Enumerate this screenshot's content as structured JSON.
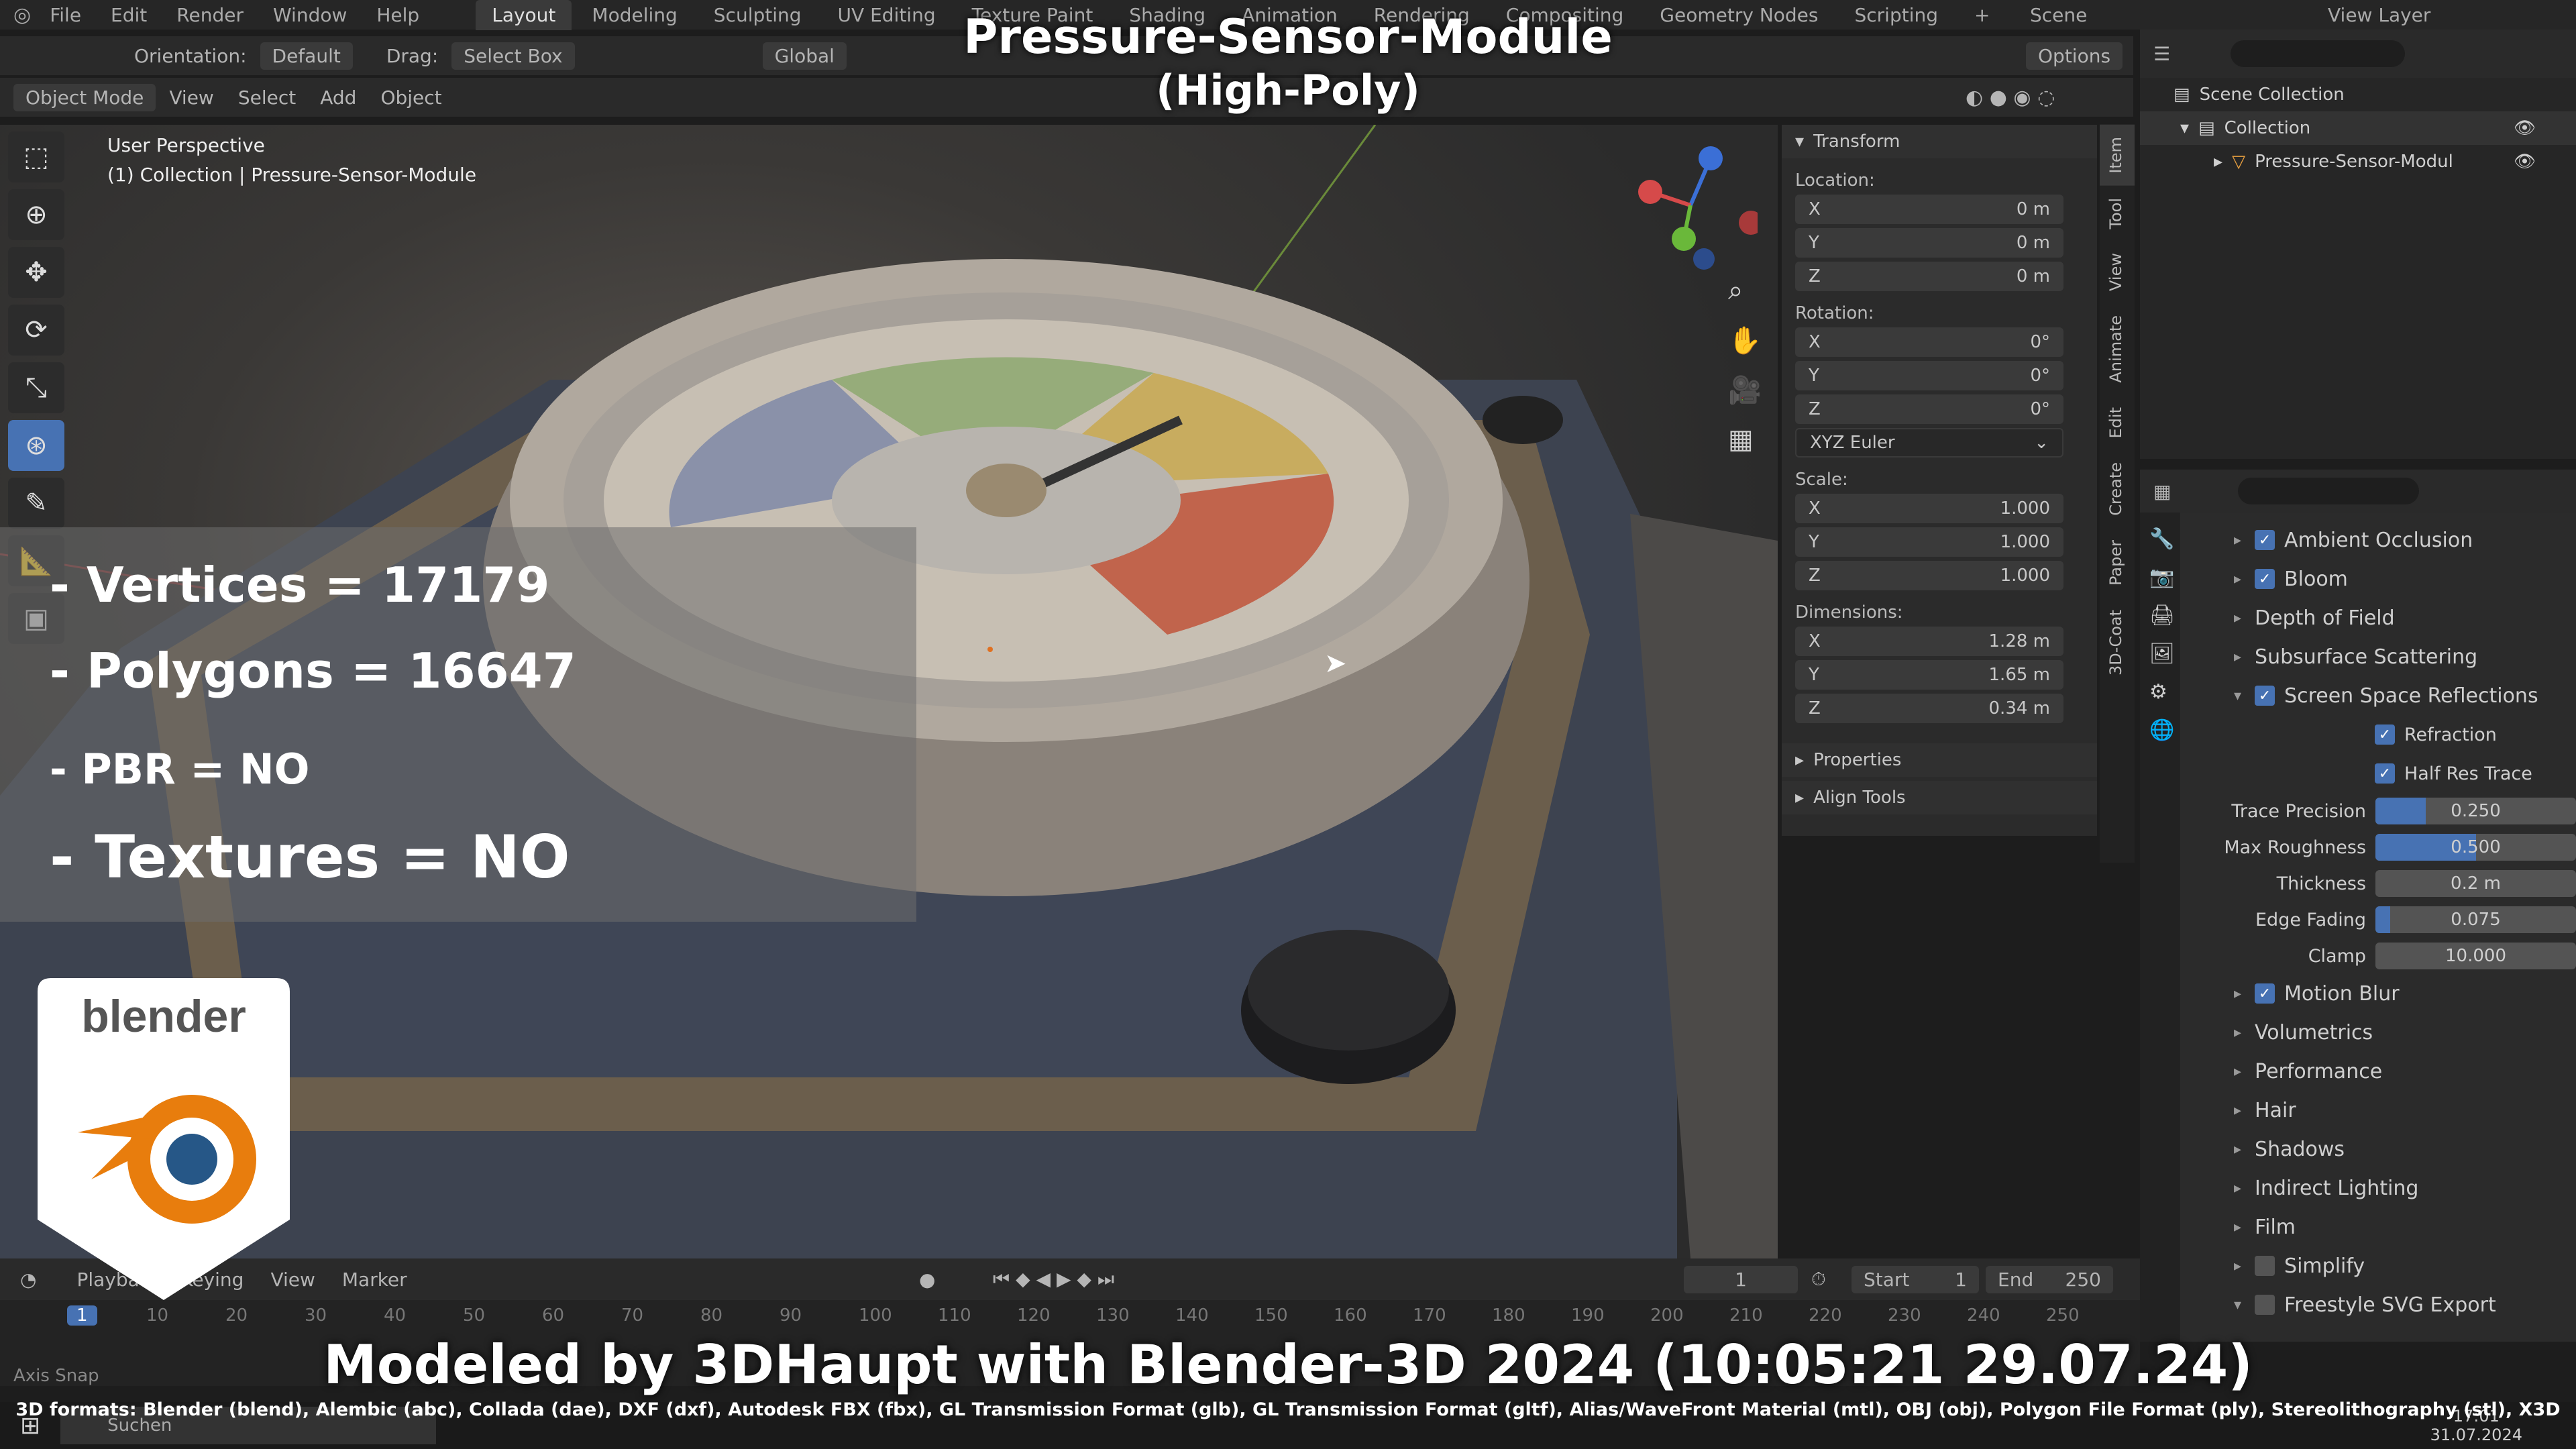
{
  "menu": [
    "File",
    "Edit",
    "Render",
    "Window",
    "Help"
  ],
  "workspaces": [
    "Layout",
    "Modeling",
    "Sculpting",
    "UV Editing",
    "Texture Paint",
    "Shading",
    "Animation",
    "Rendering",
    "Compositing",
    "Geometry Nodes",
    "Scripting"
  ],
  "scene_label": "Scene",
  "view_layer_label": "View Layer",
  "header": {
    "orientation_label": "Orientation:",
    "orientation_value": "Default",
    "drag_label": "Drag:",
    "drag_value": "Select Box",
    "global": "Global",
    "options": "Options"
  },
  "viewport_menu": {
    "mode": "Object Mode",
    "items": [
      "View",
      "Select",
      "Add",
      "Object"
    ]
  },
  "viewport_info": {
    "line1": "User Perspective",
    "line2": "(1) Collection | Pressure-Sensor-Module"
  },
  "title": {
    "line1": "Pressure-Sensor-Module",
    "line2": "(High-Poly)"
  },
  "stats": {
    "vertices": "- Vertices = 17179",
    "polygons": "- Polygons = 16647",
    "pbr": "- PBR =  NO",
    "textures": "- Textures = NO"
  },
  "logo_text": "blender",
  "transform": {
    "header": "Transform",
    "location": "Location:",
    "rotation": "Rotation:",
    "scale": "Scale:",
    "dimensions": "Dimensions:",
    "loc": [
      {
        "axis": "X",
        "val": "0 m"
      },
      {
        "axis": "Y",
        "val": "0 m"
      },
      {
        "axis": "Z",
        "val": "0 m"
      }
    ],
    "rot": [
      {
        "axis": "X",
        "val": "0°"
      },
      {
        "axis": "Y",
        "val": "0°"
      },
      {
        "axis": "Z",
        "val": "0°"
      }
    ],
    "rot_mode": "XYZ Euler",
    "scl": [
      {
        "axis": "X",
        "val": "1.000"
      },
      {
        "axis": "Y",
        "val": "1.000"
      },
      {
        "axis": "Z",
        "val": "1.000"
      }
    ],
    "dim": [
      {
        "axis": "X",
        "val": "1.28 m"
      },
      {
        "axis": "Y",
        "val": "1.65 m"
      },
      {
        "axis": "Z",
        "val": "0.34 m"
      }
    ],
    "properties": "Properties",
    "align_tools": "Align Tools"
  },
  "side_tabs": [
    "Item",
    "Tool",
    "View",
    "Animate",
    "Edit",
    "Create",
    "Paper",
    "3D-Coat"
  ],
  "outliner": {
    "scene_collection": "Scene Collection",
    "collection": "Collection",
    "object": "Pressure-Sensor-Modul"
  },
  "props": {
    "ao": "Ambient Occlusion",
    "bloom": "Bloom",
    "dof": "Depth of Field",
    "sss": "Subsurface Scattering",
    "ssr": "Screen Space Reflections",
    "refraction": "Refraction",
    "half_res": "Half Res Trace",
    "trace_precision_label": "Trace Precision",
    "trace_precision": "0.250",
    "trace_precision_pct": 25,
    "max_roughness_label": "Max Roughness",
    "max_roughness": "0.500",
    "max_roughness_pct": 50,
    "thickness_label": "Thickness",
    "thickness": "0.2 m",
    "edge_fading_label": "Edge Fading",
    "edge_fading": "0.075",
    "edge_fading_pct": 7.5,
    "clamp_label": "Clamp",
    "clamp": "10.000",
    "motion_blur": "Motion Blur",
    "volumetrics": "Volumetrics",
    "performance": "Performance",
    "hair": "Hair",
    "shadows": "Shadows",
    "indirect": "Indirect Lighting",
    "film": "Film",
    "simplify": "Simplify",
    "freestyle": "Freestyle SVG Export"
  },
  "timeline": {
    "playback": "Playback",
    "keying": "Keying",
    "view": "View",
    "marker": "Marker",
    "current_frame": "1",
    "start_label": "Start",
    "start": "1",
    "end_label": "End",
    "end": "250",
    "ticks": [
      "1",
      "10",
      "20",
      "30",
      "40",
      "50",
      "60",
      "70",
      "80",
      "90",
      "100",
      "110",
      "120",
      "130",
      "140",
      "150",
      "160",
      "170",
      "180",
      "190",
      "200",
      "210",
      "220",
      "230",
      "240",
      "250"
    ]
  },
  "status": {
    "axis_snap": "Axis Snap"
  },
  "credit": "Modeled by 3DHaupt with Blender-3D 2024 (10:05:21  29.07.24)",
  "formats": "3D formats: Blender (blend), Alembic (abc), Collada (dae), DXF (dxf), Autodesk FBX (fbx), GL Transmission Format (glb), GL Transmission Format (gltf), Alias/WaveFront Material (mtl), OBJ (obj), Polygon File Format (ply), Stereolithography (stl), X3D",
  "taskbar": {
    "search": "Suchen",
    "time": "17:01",
    "date": "31.07.2024"
  }
}
